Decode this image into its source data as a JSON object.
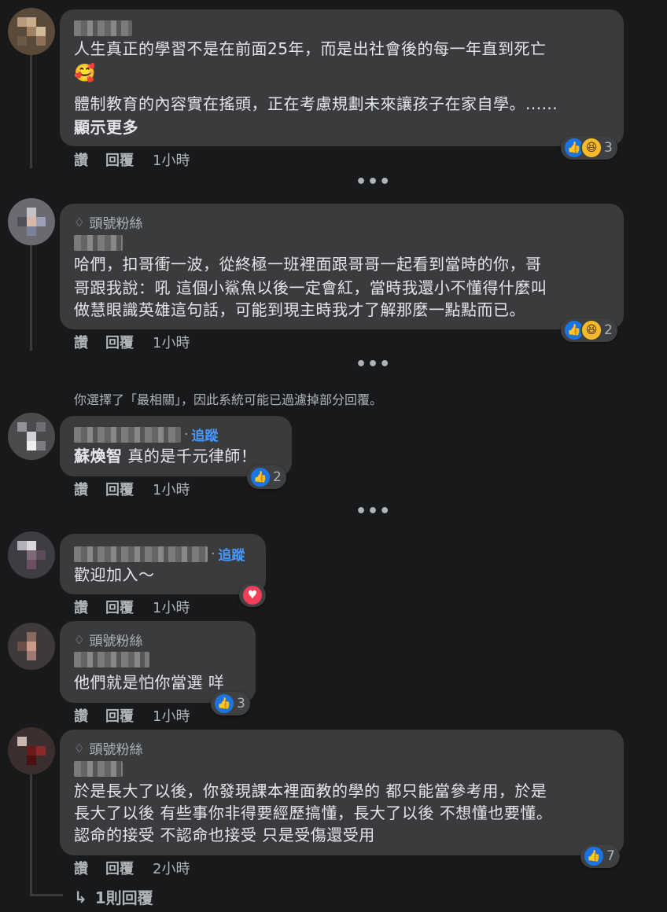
{
  "colors": {
    "background": "#18191a",
    "bubble": "#3a3b3c",
    "text": "#e4e6eb",
    "secondary": "#b0b3b8",
    "link": "#4599ff",
    "like": "#1b74e4",
    "haha": "#f7b928",
    "love": "#f33e58"
  },
  "comments": [
    {
      "text_line1": "人生真正的學習不是在前面25年，而是出社會後的每一年直到死亡",
      "emoji": "🥰",
      "text_line2": "體制教育的內容實在搖頭，正在考慮規劃未來讓孩子在家自學。......",
      "see_more": "顯示更多",
      "like": "讚",
      "reply": "回覆",
      "time": "1小時",
      "reaction_count": "3",
      "reaction_icons": [
        "like-icon",
        "haha-icon"
      ]
    },
    {
      "badge": "頭號粉絲",
      "text_line1": "哈們，扣哥衝一波，從終極一班裡面跟哥哥一起看到當時的你，哥",
      "text_line2": "哥跟我說：吼 這個小鯊魚以後一定會紅，當時我還小不懂得什麼叫",
      "text_line3": "做慧眼識英雄這句話，可能到現主時我才了解那麼一點點而已。",
      "like": "讚",
      "reply": "回覆",
      "time": "1小時",
      "reaction_count": "2",
      "reaction_icons": [
        "like-icon",
        "haha-icon"
      ]
    },
    {
      "follow": "追蹤",
      "mention": "蘇煥智",
      "text": " 真的是千元律師！",
      "like": "讚",
      "reply": "回覆",
      "time": "1小時",
      "reaction_count": "2",
      "reaction_icons": [
        "like-icon"
      ]
    },
    {
      "follow": "追蹤",
      "text": "歡迎加入～",
      "like": "讚",
      "reply": "回覆",
      "time": "1小時",
      "reaction_count": "",
      "reaction_icons": [
        "love-icon"
      ]
    },
    {
      "badge": "頭號粉絲",
      "text": "他們就是怕你當選 咩",
      "like": "讚",
      "reply": "回覆",
      "time": "1小時",
      "reaction_count": "3",
      "reaction_icons": [
        "like-icon"
      ]
    },
    {
      "badge": "頭號粉絲",
      "text_line1": "於是長大了以後，你發現課本裡面教的學的 都只能當參考用，於是",
      "text_line2": "長大了以後 有些事你非得要經歷搞懂，長大了以後 不想懂也要懂。",
      "text_line3": "認命的接受 不認命也接受 只是受傷還受用",
      "like": "讚",
      "reply": "回覆",
      "time": "2小時",
      "reaction_count": "7",
      "reaction_icons": [
        "like-icon"
      ]
    }
  ],
  "more_dots": "•••",
  "filter_notice": "你選擇了「最相關」，因此系統可能已過濾掉部分回覆。",
  "replies_link": "1則回覆",
  "replies_arrow": "↳"
}
